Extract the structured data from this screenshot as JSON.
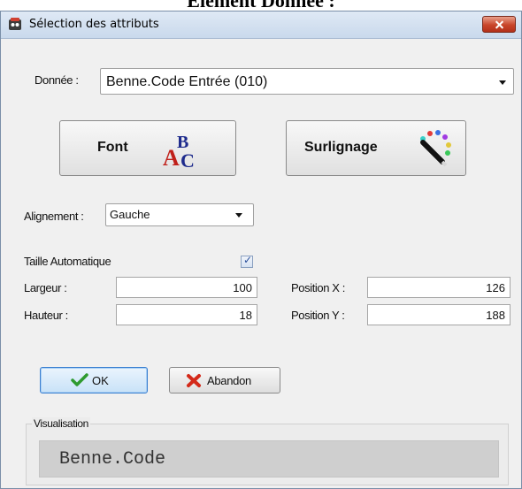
{
  "page_heading": "Element Donnée :",
  "window": {
    "title": "Sélection des attributs",
    "icon": "app-icon"
  },
  "donnee": {
    "label": "Donnée :",
    "value": "Benne.Code Entrée (010)"
  },
  "buttons": {
    "font": "Font",
    "surlignage": "Surlignage",
    "ok": "OK",
    "abandon": "Abandon"
  },
  "alignement": {
    "label": "Alignement :",
    "value": "Gauche"
  },
  "taille_auto": {
    "label": "Taille Automatique",
    "checked": true
  },
  "largeur": {
    "label": "Largeur :",
    "value": "100"
  },
  "hauteur": {
    "label": "Hauteur :",
    "value": "18"
  },
  "position_x": {
    "label": "Position X :",
    "value": "126"
  },
  "position_y": {
    "label": "Position Y :",
    "value": "188"
  },
  "visualisation": {
    "label": "Visualisation",
    "preview_text": "Benne.Code"
  },
  "colors": {
    "ok_border": "#3a7fd0",
    "close_red": "#c8452a",
    "check_blue": "#2a4f9a"
  }
}
